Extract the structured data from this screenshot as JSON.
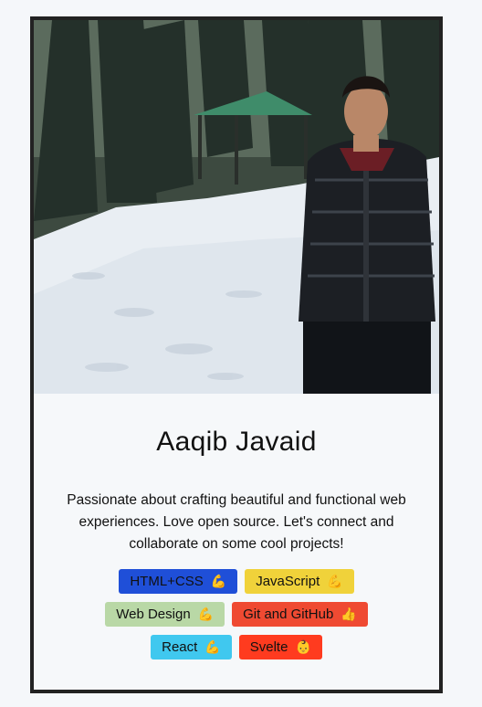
{
  "profile": {
    "name": "Aaqib Javaid",
    "bio": "Passionate about crafting beautiful and functional web experiences. Love open source. Let's connect and collaborate on some cool projects!",
    "photo_alt": "photo-of-person-in-snow"
  },
  "skills": [
    {
      "label": "HTML+CSS",
      "emoji": "💪",
      "color": "#1f4fd8"
    },
    {
      "label": "JavaScript",
      "emoji": "💪",
      "color": "#f0d23a"
    },
    {
      "label": "Web Design",
      "emoji": "💪",
      "color": "#b9d8a6"
    },
    {
      "label": "Git and GitHub",
      "emoji": "👍",
      "color": "#ef4a32"
    },
    {
      "label": "React",
      "emoji": "💪",
      "color": "#40c8ef"
    },
    {
      "label": "Svelte",
      "emoji": "👶",
      "color": "#ff3b1f"
    }
  ]
}
